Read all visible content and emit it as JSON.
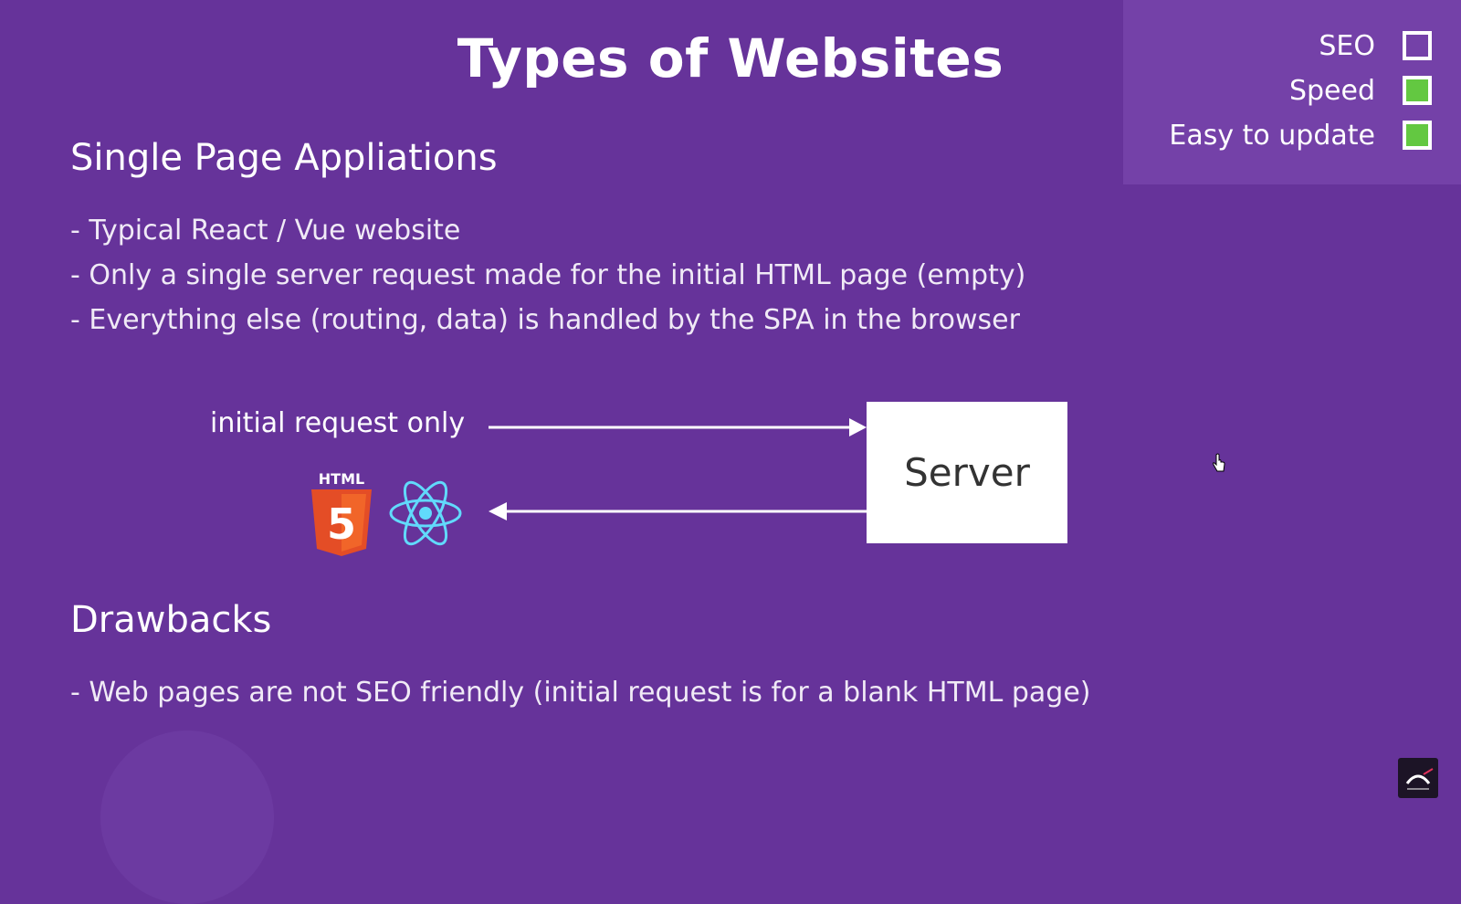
{
  "slide": {
    "title": "Types of Websites"
  },
  "legend": {
    "items": [
      {
        "label": "SEO",
        "checked": false
      },
      {
        "label": "Speed",
        "checked": true
      },
      {
        "label": "Easy to update",
        "checked": true
      }
    ],
    "checked_color": "#63c841"
  },
  "section1": {
    "heading": "Single Page Appliations",
    "bullets": [
      "- Typical React / Vue website",
      "- Only a single server request made for the initial HTML page (empty)",
      "- Everything else (routing, data) is handled by the SPA in the browser"
    ]
  },
  "diagram": {
    "request_label": "initial request only",
    "server_label": "Server",
    "html5_badge": "HTML",
    "html5_digit": "5",
    "icons": [
      "html5-icon",
      "react-icon"
    ]
  },
  "section2": {
    "heading": "Drawbacks",
    "bullets": [
      "- Web pages are not SEO friendly (initial request is for a blank HTML page)"
    ]
  },
  "colors": {
    "background": "#66339a",
    "legend_panel": "#7441a8",
    "html5_orange": "#e44d26",
    "react_blue": "#61dafb"
  }
}
